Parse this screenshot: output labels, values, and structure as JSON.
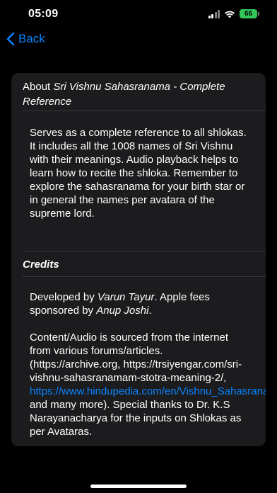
{
  "status_bar": {
    "time": "05:09",
    "battery": "66",
    "icons": [
      "cellular-signal-icon",
      "wifi-icon",
      "battery-charging-icon"
    ]
  },
  "nav": {
    "back_label": "Back"
  },
  "about": {
    "header_prefix": "About ",
    "header_title": "Sri Vishnu Sahasranama - Complete Reference",
    "body": "Serves as a complete reference to all shlokas. It includes all the 1008 names of Sri Vishnu with their meanings. Audio playback helps to learn how to recite the shloka. Remember to explore the sahasranama for your birth star or in general the names per avatara of the supreme lord."
  },
  "credits": {
    "header": "Credits",
    "developed_prefix": "Developed by ",
    "developer": "Varun Tayur",
    "fees_text": ". Apple fees sponsored by ",
    "sponsor": "Anup Joshi",
    "sponsor_suffix": ".",
    "content_text": "Content/Audio is sourced from the internet from various forums/articles. (https://archive.org, https://trsiyengar.com/sri-vishnu-sahasranamam-stotra-meaning-2/, ",
    "link": "https://www.hindupedia.com/en/Vishnu_Sahasranamam",
    "content_suffix": " and many more). Special thanks to Dr. K.S Narayanacharya for the inputs on Shlokas as per Avataras."
  },
  "colors": {
    "accent": "#0a84ff",
    "card": "#1c1c1e",
    "battery": "#33c759"
  }
}
